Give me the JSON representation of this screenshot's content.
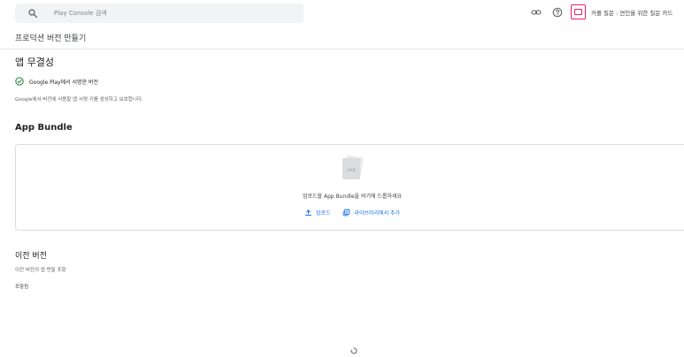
{
  "search": {
    "placeholder": "Play Console 검색"
  },
  "topbar": {
    "icons": [
      "link-icon",
      "help-icon"
    ],
    "app_name": "커플 질문 : 연인을 위한 질문 카드"
  },
  "header": {
    "title": "프로덕션 버전 만들기"
  },
  "integrity": {
    "title": "앱 무결성",
    "signed_label": "Google Play에서 서명한 버전",
    "description": "Google에서 버전에 사용할 앱 서명 키를 생성하고 보호합니다."
  },
  "bundle": {
    "title": "App Bundle",
    "icon_label": "AAB",
    "drop_text": "업로드할 App Bundle을 여기에 드롭하세요",
    "upload_label": "업로드",
    "library_label": "라이브러리에서 추가"
  },
  "previous": {
    "title": "이전 버전",
    "description": "이전 버전의 앱 번들 포함",
    "include_label": "포함됨"
  },
  "colors": {
    "accent": "#1a73e8",
    "success": "#188038",
    "brand": "#e91e63"
  }
}
